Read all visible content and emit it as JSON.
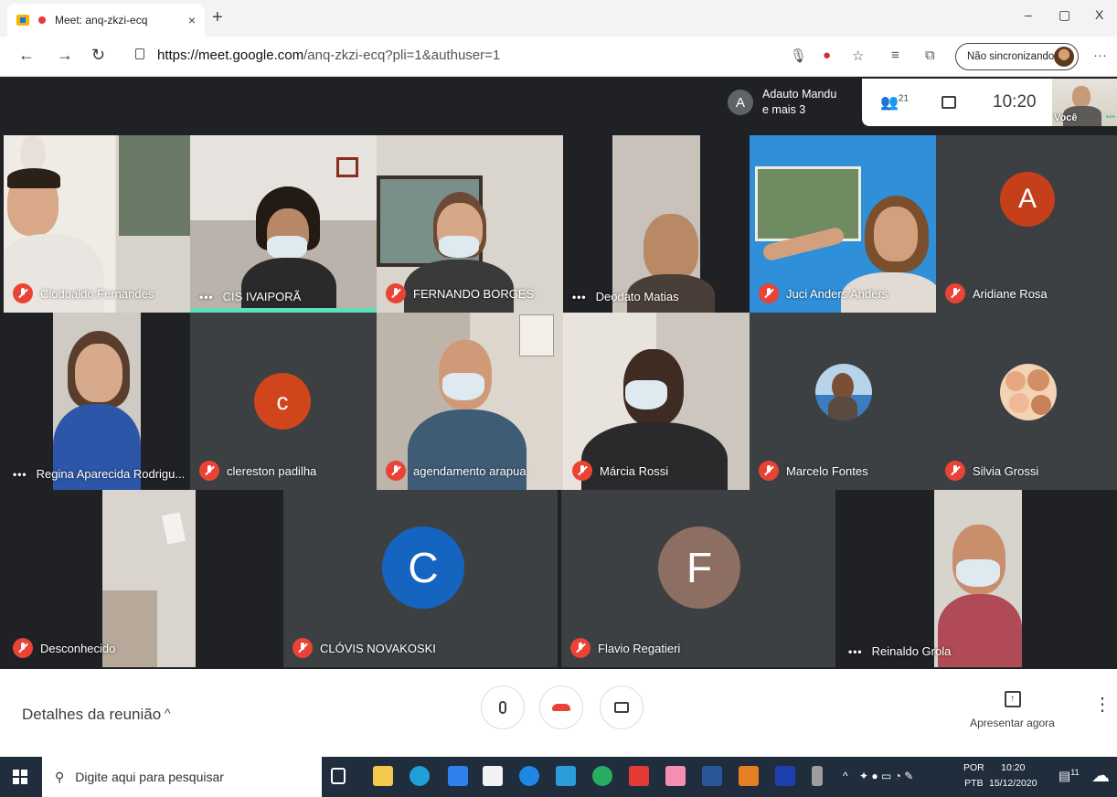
{
  "browser": {
    "tab_title": "Meet: anq-zkzi-ecq",
    "tab_close": "×",
    "new_tab": "+",
    "win_min": "–",
    "win_max": "▢",
    "win_close": "X",
    "url_host": "https://meet.google.com",
    "url_path": "/anq-zkzi-ecq?pli=1&authuser=1",
    "sync_label": "Não sincronizando",
    "more": "···"
  },
  "meet": {
    "presenter_initial": "A",
    "presenter_line1": "Adauto Mandu",
    "presenter_line2": "e mais 3",
    "people_count": "21",
    "time": "10:20",
    "self_label": "Você",
    "self_dots": "•••"
  },
  "participants": [
    {
      "name": "Clodoaldo Fernandes",
      "muted": true
    },
    {
      "name": "CIS IVAIPORÃ",
      "muted": false
    },
    {
      "name": "FERNANDO BORGES",
      "muted": true
    },
    {
      "name": "Deodato Matias",
      "muted": false
    },
    {
      "name": "Juci Anders Anders",
      "muted": true
    },
    {
      "name": "Aridiane Rosa",
      "muted": true,
      "initial": "A",
      "color": "#c5401a"
    },
    {
      "name": "Regina Aparecida Rodrigu...",
      "muted": false
    },
    {
      "name": "clereston padilha",
      "muted": true,
      "initial": "c",
      "color": "#d0451b"
    },
    {
      "name": "agendamento arapua",
      "muted": true
    },
    {
      "name": "Márcia Rossi",
      "muted": true
    },
    {
      "name": "Marcelo Fontes",
      "muted": true
    },
    {
      "name": "Silvia Grossi",
      "muted": true
    },
    {
      "name": "Desconhecido",
      "muted": true
    },
    {
      "name": "CLÓVIS NOVAKOSKI",
      "muted": true,
      "initial": "C",
      "color": "#1565c0"
    },
    {
      "name": "Flavio Regatieri",
      "muted": true,
      "initial": "F",
      "color": "#8d6e63"
    },
    {
      "name": "Reinaldo Grola",
      "muted": false
    }
  ],
  "dots": "•••",
  "bottombar": {
    "details": "Detalhes da reunião",
    "chevron": "^",
    "present_label": "Apresentar agora",
    "more": "⋮"
  },
  "taskbar": {
    "search_placeholder": "Digite aqui para pesquisar",
    "lang1": "POR",
    "lang2": "PTB",
    "time": "10:20",
    "date": "15/12/2020",
    "notif_count": "11",
    "tray_arrow": "^"
  }
}
